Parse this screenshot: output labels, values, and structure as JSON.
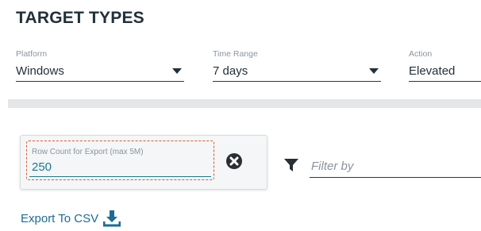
{
  "page": {
    "title": "TARGET TYPES"
  },
  "filters": {
    "platform": {
      "label": "Platform",
      "value": "Windows"
    },
    "time_range": {
      "label": "Time Range",
      "value": "7 days"
    },
    "action": {
      "label": "Action",
      "value": "Elevated"
    }
  },
  "export_panel": {
    "row_count_label": "Row Count for Export (max 5M)",
    "row_count_value": "250",
    "clear_icon": "times-circle-icon"
  },
  "filter_bar": {
    "icon": "funnel-icon",
    "placeholder": "Filter by"
  },
  "export_link": {
    "label": "Export To CSV",
    "icon": "download-icon"
  },
  "colors": {
    "accent_teal": "#1a7a8c",
    "link_blue": "#1a6d96",
    "focus_orange": "#d4602a",
    "divider_gray": "#e4e6e8"
  }
}
